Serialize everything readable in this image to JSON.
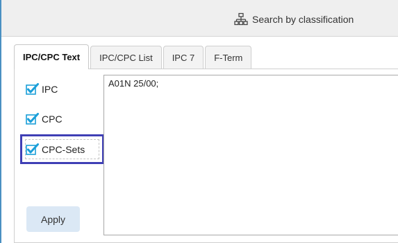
{
  "toolbar": {
    "search_label": "Search by classification",
    "search_icon": "sitemap-icon"
  },
  "tabs": [
    {
      "label": "IPC/CPC Text",
      "active": true
    },
    {
      "label": "IPC/CPC List",
      "active": false
    },
    {
      "label": "IPC 7",
      "active": false
    },
    {
      "label": "F-Term",
      "active": false
    }
  ],
  "options": [
    {
      "label": "IPC",
      "checked": true
    },
    {
      "label": "CPC",
      "checked": true
    },
    {
      "label": "CPC-Sets",
      "checked": true
    }
  ],
  "query_text": "A01N 25/00;",
  "apply_label": "Apply",
  "colors": {
    "checkbox_check": "#1a9fd9",
    "highlight_border": "#3f3fb5",
    "apply_bg": "#dbe8f5",
    "window_accent": "#4a90c2"
  }
}
